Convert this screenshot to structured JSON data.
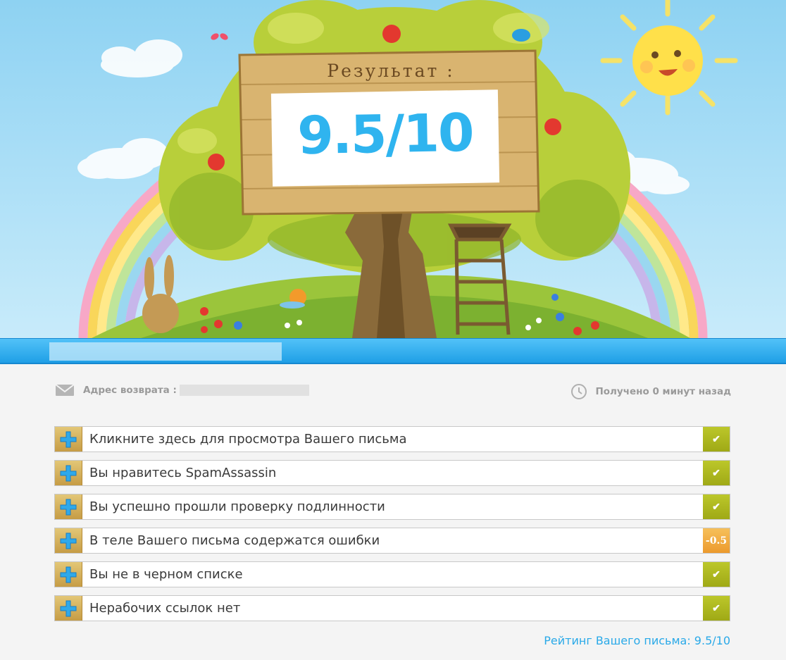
{
  "hero": {
    "title": "Результат :",
    "score": "9.5/10"
  },
  "info": {
    "return_label": "Адрес возврата :",
    "received": "Получено 0 минут назад"
  },
  "checks": [
    {
      "label": "Кликните здесь для просмотра Вашего письма",
      "status": "ok",
      "value": "✔"
    },
    {
      "label": "Вы нравитесь SpamAssassin",
      "status": "ok",
      "value": "✔"
    },
    {
      "label": "Вы успешно прошли проверку подлинности",
      "status": "ok",
      "value": "✔"
    },
    {
      "label": "В теле Вашего письма содержатся ошибки",
      "status": "warn",
      "value": "-0.5"
    },
    {
      "label": "Вы не в черном списке",
      "status": "ok",
      "value": "✔"
    },
    {
      "label": "Нерабочих ссылок нет",
      "status": "ok",
      "value": "✔"
    }
  ],
  "rating": "Рейтинг Вашего письма: 9.5/10",
  "colors": {
    "accent": "#29a9e8",
    "ok": "#aab520",
    "warn": "#f0a83a",
    "plus": "#d4af5a"
  },
  "icons": [
    "plus-icon",
    "check-icon",
    "envelope-icon",
    "clock-icon"
  ]
}
